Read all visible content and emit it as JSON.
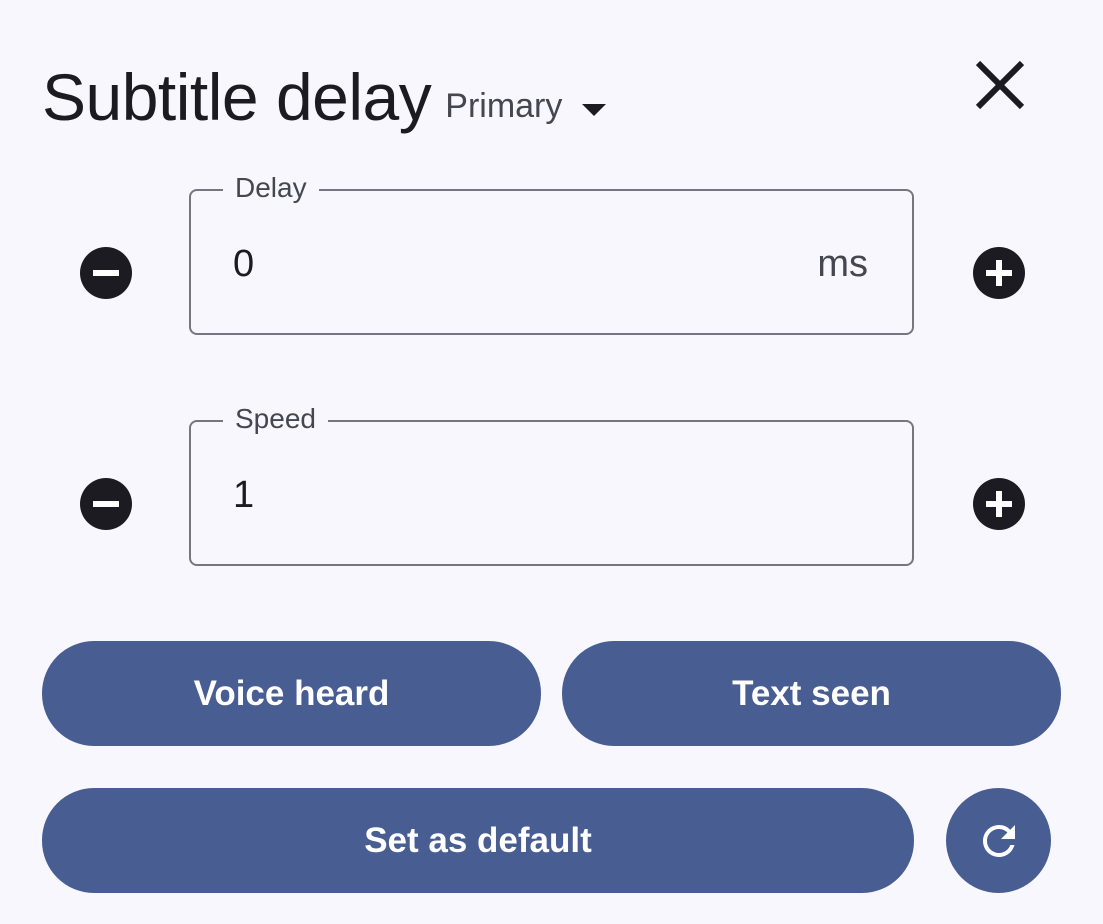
{
  "header": {
    "title": "Subtitle delay",
    "track_select": {
      "value": "Primary"
    }
  },
  "icons": {
    "close": "close-icon",
    "decrement": "minus-circle-icon",
    "increment": "plus-circle-icon",
    "reset": "refresh-icon"
  },
  "delay_field": {
    "label": "Delay",
    "value": "0",
    "suffix": "ms"
  },
  "speed_field": {
    "label": "Speed",
    "value": "1"
  },
  "buttons": {
    "voice_heard": "Voice heard",
    "text_seen": "Text seen",
    "set_default": "Set as default"
  },
  "colors": {
    "background": "#f8f7fd",
    "primary": "#485d92",
    "icon": "#1b1b21",
    "outline": "#777680"
  }
}
